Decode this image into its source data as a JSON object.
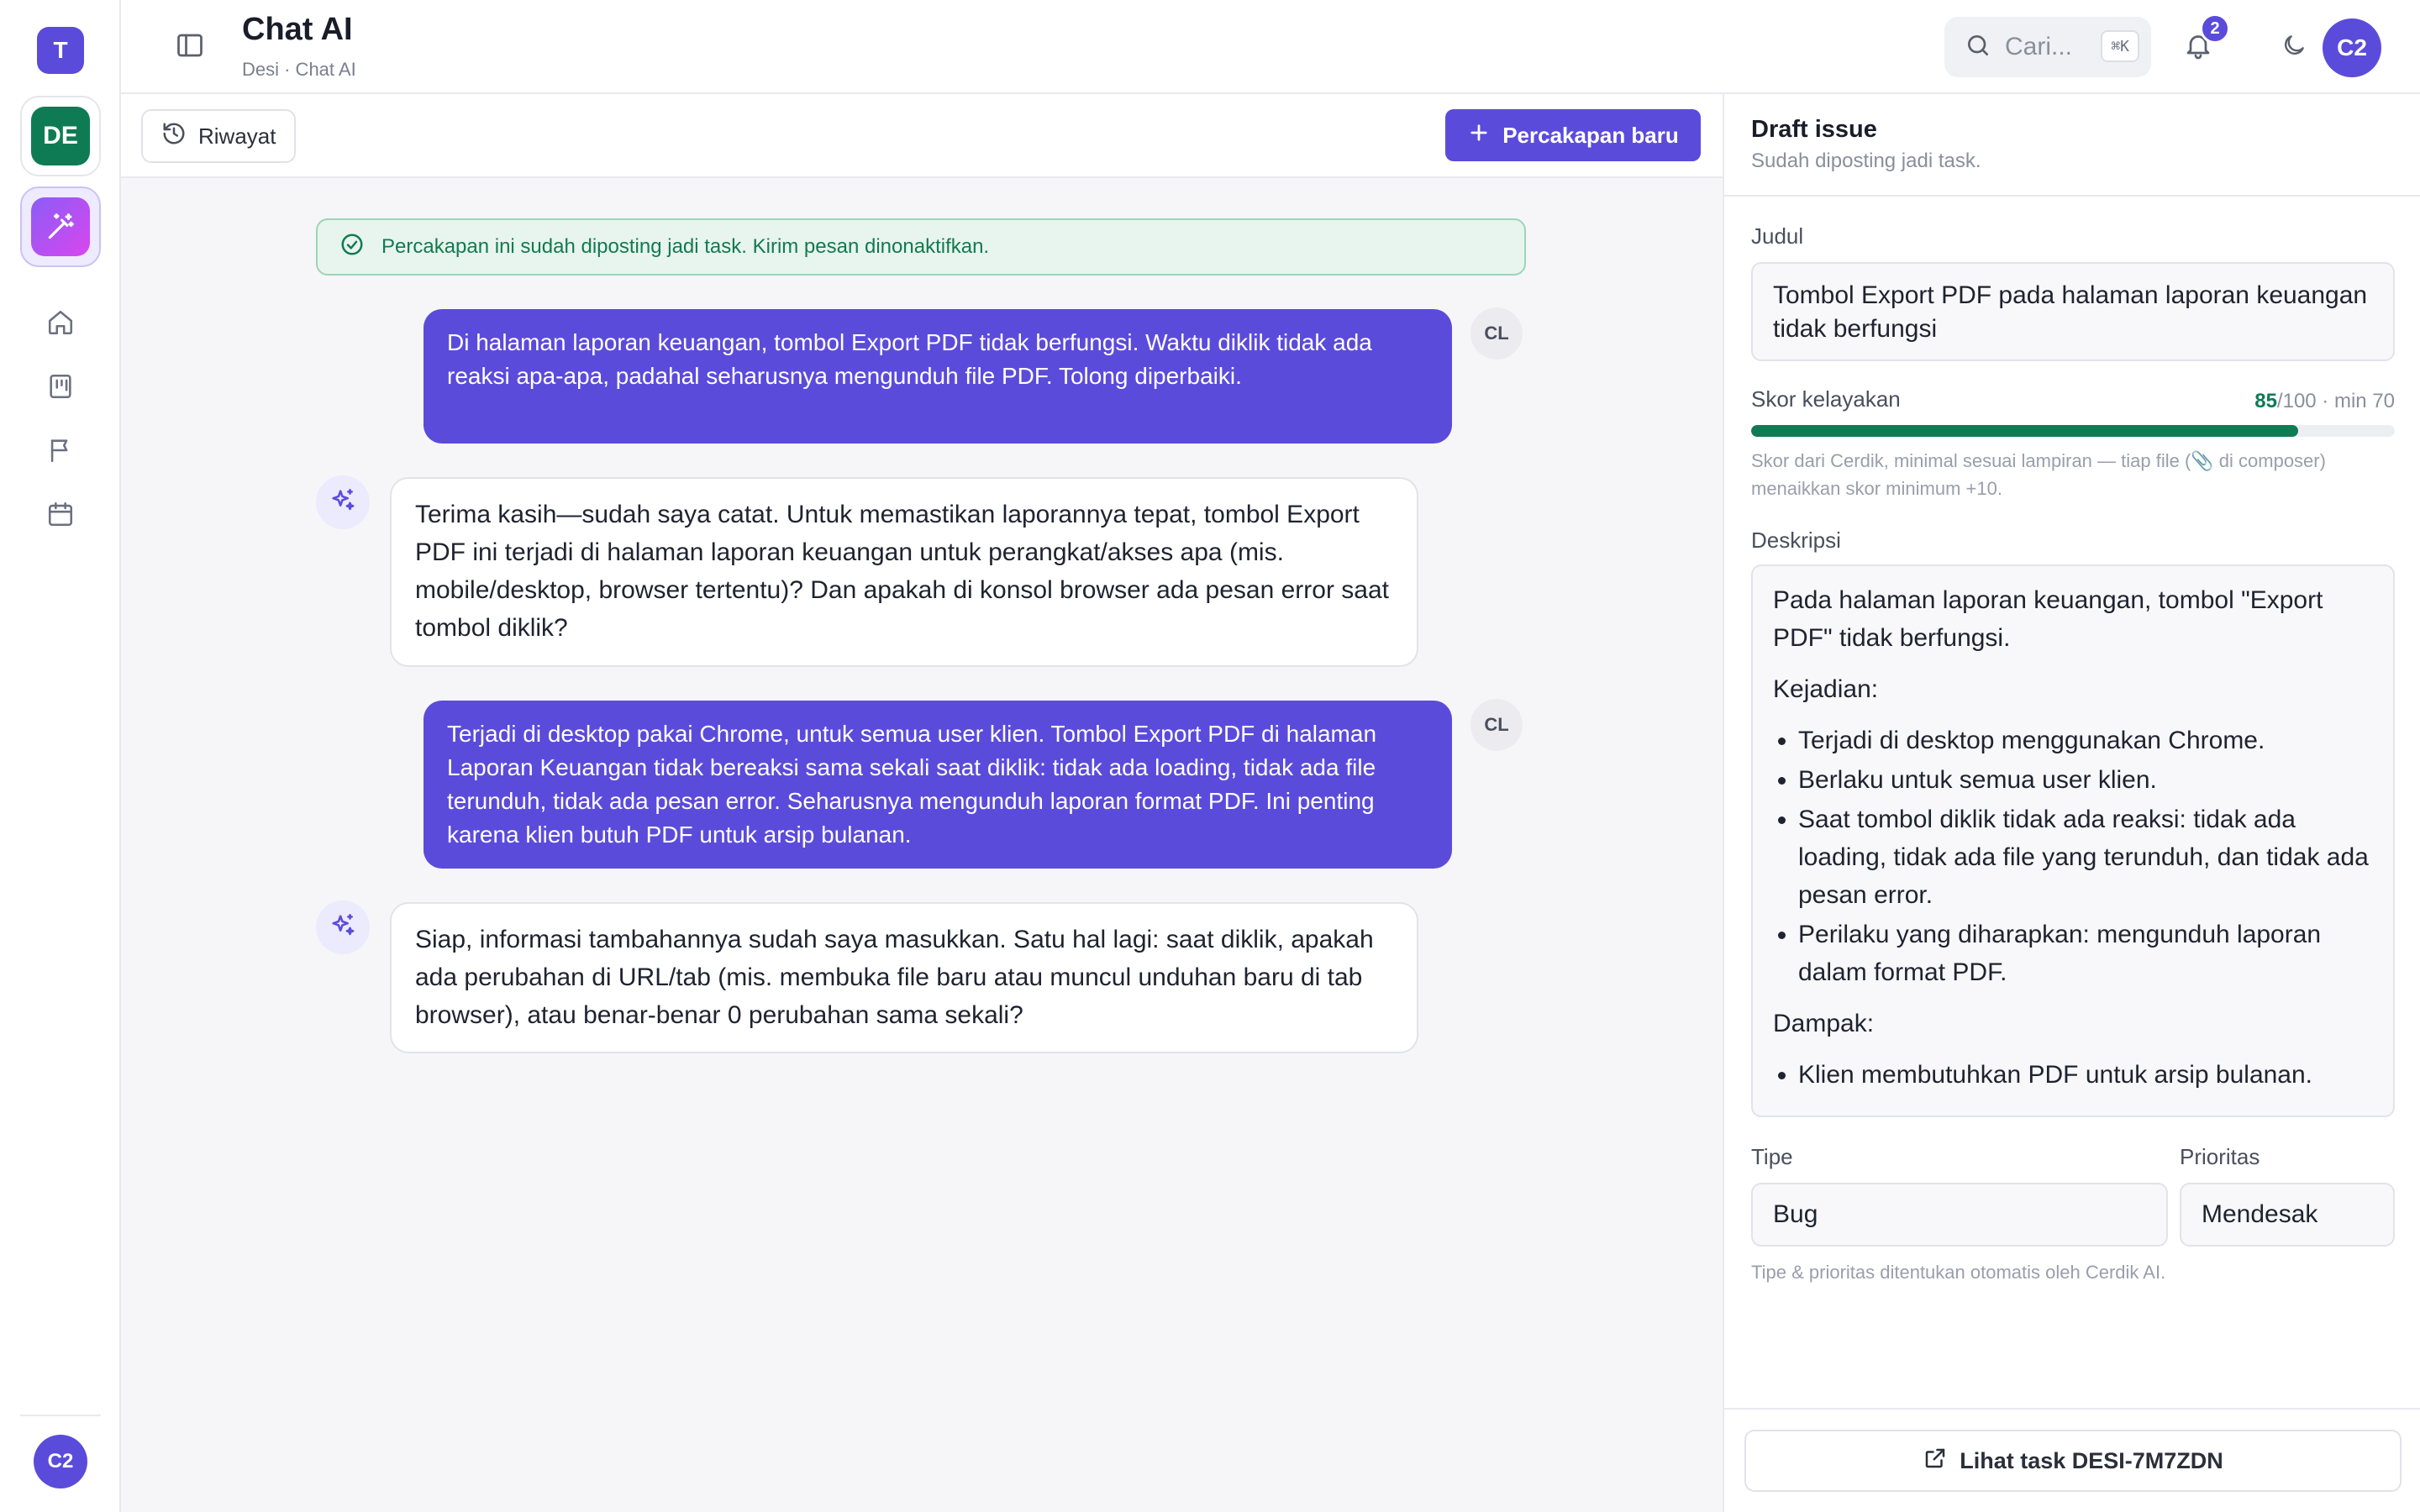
{
  "rail": {
    "logo_letter": "T",
    "workspace_initials": "DE",
    "user_initials": "C2",
    "nav_icons": [
      "home-icon",
      "board-icon",
      "flag-icon",
      "calendar-icon"
    ]
  },
  "header": {
    "title": "Chat AI",
    "breadcrumb": "Desi · Chat AI",
    "search_placeholder": "Cari...",
    "search_shortcut": "⌘K",
    "notification_count": "2",
    "user_initials": "C2"
  },
  "toolbar": {
    "history_label": "Riwayat",
    "new_chat_label": "Percakapan baru"
  },
  "notice": "Percakapan ini sudah diposting jadi task. Kirim pesan dinonaktifkan.",
  "messages": [
    {
      "role": "user",
      "avatar": "CL",
      "text": "Di halaman laporan keuangan, tombol Export PDF tidak berfungsi. Waktu diklik tidak ada reaksi apa-apa, padahal seharusnya mengunduh file PDF. Tolong diperbaiki."
    },
    {
      "role": "assistant",
      "text": "Terima kasih—sudah saya catat. Untuk memastikan laporannya tepat, tombol Export PDF ini terjadi di halaman laporan keuangan untuk perangkat/akses apa (mis. mobile/desktop, browser tertentu)? Dan apakah di konsol browser ada pesan error saat tombol diklik?"
    },
    {
      "role": "user",
      "avatar": "CL",
      "text": "Terjadi di desktop pakai Chrome, untuk semua user klien. Tombol Export PDF di halaman Laporan Keuangan tidak bereaksi sama sekali saat diklik: tidak ada loading, tidak ada file terunduh, tidak ada pesan error. Seharusnya mengunduh laporan format PDF. Ini penting karena klien butuh PDF untuk arsip bulanan."
    },
    {
      "role": "assistant",
      "text": "Siap, informasi tambahannya sudah saya masukkan. Satu hal lagi: saat diklik, apakah ada perubahan di URL/tab (mis. membuka file baru atau muncul unduhan baru di tab browser), atau benar-benar 0 perubahan sama sekali?"
    }
  ],
  "draft": {
    "heading": "Draft issue",
    "subheading": "Sudah diposting jadi task.",
    "title_label": "Judul",
    "title_value": "Tombol Export PDF pada halaman laporan keuangan tidak berfungsi",
    "score_label": "Skor kelayakan",
    "score_value": "85",
    "score_suffix": "/100 · min 70",
    "score_fraction": 0.85,
    "score_hint": "Skor dari Cerdik, minimal sesuai lampiran — tiap file (📎 di composer) menaikkan skor minimum +10.",
    "desc_label": "Deskripsi",
    "desc_intro": "Pada halaman laporan keuangan, tombol \"Export PDF\" tidak berfungsi.",
    "desc_kejadian_heading": "Kejadian:",
    "desc_kejadian": [
      "Terjadi di desktop menggunakan Chrome.",
      "Berlaku untuk semua user klien.",
      "Saat tombol diklik tidak ada reaksi: tidak ada loading, tidak ada file yang terunduh, dan tidak ada pesan error.",
      "Perilaku yang diharapkan: mengunduh laporan dalam format PDF."
    ],
    "desc_dampak_heading": "Dampak:",
    "desc_dampak": [
      "Klien membutuhkan PDF untuk arsip bulanan."
    ],
    "type_label": "Tipe",
    "type_value": "Bug",
    "priority_label": "Prioritas",
    "priority_value": "Mendesak",
    "auto_hint": "Tipe & prioritas ditentukan otomatis oleh Cerdik AI.",
    "view_task_label": "Lihat task DESI-7M7ZDN"
  },
  "colors": {
    "accent": "#5b4bdb",
    "success": "#0f7b55",
    "notice_bg": "#e7f5ee"
  }
}
